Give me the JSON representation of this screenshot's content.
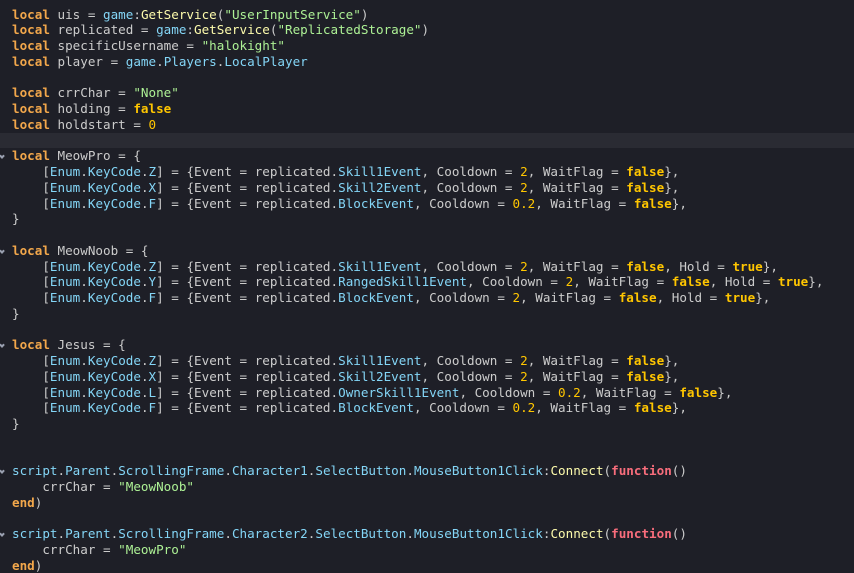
{
  "colors": {
    "background": "#1e1f27",
    "current_line": "#2a2b33",
    "keyword": "#f2a74b",
    "builtin": "#84d6f7",
    "method": "#fdfbac",
    "string": "#adf195",
    "boolean": "#ffc600",
    "number": "#ffc600",
    "function": "#f86d7c",
    "plain": "#cccccc"
  },
  "icons": {
    "fold": "fold-arrow-icon"
  },
  "lines": [
    {
      "tokens": [
        [
          "keyword",
          "local"
        ],
        [
          "plain",
          " uis = "
        ],
        [
          "builtin",
          "game"
        ],
        [
          "plain",
          ":"
        ],
        [
          "method",
          "GetService"
        ],
        [
          "plain",
          "("
        ],
        [
          "string",
          "\"UserInputService\""
        ],
        [
          "plain",
          ")"
        ]
      ]
    },
    {
      "tokens": [
        [
          "keyword",
          "local"
        ],
        [
          "plain",
          " replicated = "
        ],
        [
          "builtin",
          "game"
        ],
        [
          "plain",
          ":"
        ],
        [
          "method",
          "GetService"
        ],
        [
          "plain",
          "("
        ],
        [
          "string",
          "\"ReplicatedStorage\""
        ],
        [
          "plain",
          ")"
        ]
      ]
    },
    {
      "tokens": [
        [
          "keyword",
          "local"
        ],
        [
          "plain",
          " specificUsername = "
        ],
        [
          "string",
          "\"halokight\""
        ]
      ]
    },
    {
      "tokens": [
        [
          "keyword",
          "local"
        ],
        [
          "plain",
          " player = "
        ],
        [
          "builtin",
          "game"
        ],
        [
          "plain",
          "."
        ],
        [
          "builtin",
          "Players"
        ],
        [
          "plain",
          "."
        ],
        [
          "builtin",
          "LocalPlayer"
        ]
      ]
    },
    {
      "tokens": []
    },
    {
      "tokens": [
        [
          "keyword",
          "local"
        ],
        [
          "plain",
          " crrChar = "
        ],
        [
          "string",
          "\"None\""
        ]
      ]
    },
    {
      "tokens": [
        [
          "keyword",
          "local"
        ],
        [
          "plain",
          " holding = "
        ],
        [
          "boolean",
          "false"
        ]
      ]
    },
    {
      "tokens": [
        [
          "keyword",
          "local"
        ],
        [
          "plain",
          " holdstart = "
        ],
        [
          "number",
          "0"
        ]
      ]
    },
    {
      "current": true,
      "tokens": []
    },
    {
      "fold": true,
      "tokens": [
        [
          "keyword",
          "local"
        ],
        [
          "plain",
          " MeowPro = {"
        ]
      ]
    },
    {
      "tokens": [
        [
          "plain",
          "    ["
        ],
        [
          "builtin",
          "Enum"
        ],
        [
          "plain",
          "."
        ],
        [
          "builtin",
          "KeyCode"
        ],
        [
          "plain",
          "."
        ],
        [
          "builtin",
          "Z"
        ],
        [
          "plain",
          "] = {Event = replicated."
        ],
        [
          "builtin",
          "Skill1Event"
        ],
        [
          "plain",
          ", Cooldown = "
        ],
        [
          "number",
          "2"
        ],
        [
          "plain",
          ", WaitFlag = "
        ],
        [
          "boolean",
          "false"
        ],
        [
          "plain",
          "},"
        ]
      ]
    },
    {
      "tokens": [
        [
          "plain",
          "    ["
        ],
        [
          "builtin",
          "Enum"
        ],
        [
          "plain",
          "."
        ],
        [
          "builtin",
          "KeyCode"
        ],
        [
          "plain",
          "."
        ],
        [
          "builtin",
          "X"
        ],
        [
          "plain",
          "] = {Event = replicated."
        ],
        [
          "builtin",
          "Skill2Event"
        ],
        [
          "plain",
          ", Cooldown = "
        ],
        [
          "number",
          "2"
        ],
        [
          "plain",
          ", WaitFlag = "
        ],
        [
          "boolean",
          "false"
        ],
        [
          "plain",
          "},"
        ]
      ]
    },
    {
      "tokens": [
        [
          "plain",
          "    ["
        ],
        [
          "builtin",
          "Enum"
        ],
        [
          "plain",
          "."
        ],
        [
          "builtin",
          "KeyCode"
        ],
        [
          "plain",
          "."
        ],
        [
          "builtin",
          "F"
        ],
        [
          "plain",
          "] = {Event = replicated."
        ],
        [
          "builtin",
          "BlockEvent"
        ],
        [
          "plain",
          ", Cooldown = "
        ],
        [
          "number",
          "0.2"
        ],
        [
          "plain",
          ", WaitFlag = "
        ],
        [
          "boolean",
          "false"
        ],
        [
          "plain",
          "},"
        ]
      ]
    },
    {
      "tokens": [
        [
          "plain",
          "}"
        ]
      ]
    },
    {
      "tokens": []
    },
    {
      "fold": true,
      "tokens": [
        [
          "keyword",
          "local"
        ],
        [
          "plain",
          " MeowNoob = {"
        ]
      ]
    },
    {
      "tokens": [
        [
          "plain",
          "    ["
        ],
        [
          "builtin",
          "Enum"
        ],
        [
          "plain",
          "."
        ],
        [
          "builtin",
          "KeyCode"
        ],
        [
          "plain",
          "."
        ],
        [
          "builtin",
          "Z"
        ],
        [
          "plain",
          "] = {Event = replicated."
        ],
        [
          "builtin",
          "Skill1Event"
        ],
        [
          "plain",
          ", Cooldown = "
        ],
        [
          "number",
          "2"
        ],
        [
          "plain",
          ", WaitFlag = "
        ],
        [
          "boolean",
          "false"
        ],
        [
          "plain",
          ", Hold = "
        ],
        [
          "boolean",
          "true"
        ],
        [
          "plain",
          "},"
        ]
      ]
    },
    {
      "tokens": [
        [
          "plain",
          "    ["
        ],
        [
          "builtin",
          "Enum"
        ],
        [
          "plain",
          "."
        ],
        [
          "builtin",
          "KeyCode"
        ],
        [
          "plain",
          "."
        ],
        [
          "builtin",
          "Y"
        ],
        [
          "plain",
          "] = {Event = replicated."
        ],
        [
          "builtin",
          "RangedSkill1Event"
        ],
        [
          "plain",
          ", Cooldown = "
        ],
        [
          "number",
          "2"
        ],
        [
          "plain",
          ", WaitFlag = "
        ],
        [
          "boolean",
          "false"
        ],
        [
          "plain",
          ", Hold = "
        ],
        [
          "boolean",
          "true"
        ],
        [
          "plain",
          "},"
        ]
      ]
    },
    {
      "tokens": [
        [
          "plain",
          "    ["
        ],
        [
          "builtin",
          "Enum"
        ],
        [
          "plain",
          "."
        ],
        [
          "builtin",
          "KeyCode"
        ],
        [
          "plain",
          "."
        ],
        [
          "builtin",
          "F"
        ],
        [
          "plain",
          "] = {Event = replicated."
        ],
        [
          "builtin",
          "BlockEvent"
        ],
        [
          "plain",
          ", Cooldown = "
        ],
        [
          "number",
          "2"
        ],
        [
          "plain",
          ", WaitFlag = "
        ],
        [
          "boolean",
          "false"
        ],
        [
          "plain",
          ", Hold = "
        ],
        [
          "boolean",
          "true"
        ],
        [
          "plain",
          "},"
        ]
      ]
    },
    {
      "tokens": [
        [
          "plain",
          "}"
        ]
      ]
    },
    {
      "tokens": []
    },
    {
      "fold": true,
      "tokens": [
        [
          "keyword",
          "local"
        ],
        [
          "plain",
          " Jesus = {"
        ]
      ]
    },
    {
      "tokens": [
        [
          "plain",
          "    ["
        ],
        [
          "builtin",
          "Enum"
        ],
        [
          "plain",
          "."
        ],
        [
          "builtin",
          "KeyCode"
        ],
        [
          "plain",
          "."
        ],
        [
          "builtin",
          "Z"
        ],
        [
          "plain",
          "] = {Event = replicated."
        ],
        [
          "builtin",
          "Skill1Event"
        ],
        [
          "plain",
          ", Cooldown = "
        ],
        [
          "number",
          "2"
        ],
        [
          "plain",
          ", WaitFlag = "
        ],
        [
          "boolean",
          "false"
        ],
        [
          "plain",
          "},"
        ]
      ]
    },
    {
      "tokens": [
        [
          "plain",
          "    ["
        ],
        [
          "builtin",
          "Enum"
        ],
        [
          "plain",
          "."
        ],
        [
          "builtin",
          "KeyCode"
        ],
        [
          "plain",
          "."
        ],
        [
          "builtin",
          "X"
        ],
        [
          "plain",
          "] = {Event = replicated."
        ],
        [
          "builtin",
          "Skill2Event"
        ],
        [
          "plain",
          ", Cooldown = "
        ],
        [
          "number",
          "2"
        ],
        [
          "plain",
          ", WaitFlag = "
        ],
        [
          "boolean",
          "false"
        ],
        [
          "plain",
          "},"
        ]
      ]
    },
    {
      "tokens": [
        [
          "plain",
          "    ["
        ],
        [
          "builtin",
          "Enum"
        ],
        [
          "plain",
          "."
        ],
        [
          "builtin",
          "KeyCode"
        ],
        [
          "plain",
          "."
        ],
        [
          "builtin",
          "L"
        ],
        [
          "plain",
          "] = {Event = replicated."
        ],
        [
          "builtin",
          "OwnerSkill1Event"
        ],
        [
          "plain",
          ", Cooldown = "
        ],
        [
          "number",
          "0.2"
        ],
        [
          "plain",
          ", WaitFlag = "
        ],
        [
          "boolean",
          "false"
        ],
        [
          "plain",
          "},"
        ]
      ]
    },
    {
      "tokens": [
        [
          "plain",
          "    ["
        ],
        [
          "builtin",
          "Enum"
        ],
        [
          "plain",
          "."
        ],
        [
          "builtin",
          "KeyCode"
        ],
        [
          "plain",
          "."
        ],
        [
          "builtin",
          "F"
        ],
        [
          "plain",
          "] = {Event = replicated."
        ],
        [
          "builtin",
          "BlockEvent"
        ],
        [
          "plain",
          ", Cooldown = "
        ],
        [
          "number",
          "0.2"
        ],
        [
          "plain",
          ", WaitFlag = "
        ],
        [
          "boolean",
          "false"
        ],
        [
          "plain",
          "},"
        ]
      ]
    },
    {
      "tokens": [
        [
          "plain",
          "}"
        ]
      ]
    },
    {
      "tokens": []
    },
    {
      "tokens": []
    },
    {
      "fold": true,
      "tokens": [
        [
          "builtin",
          "script"
        ],
        [
          "plain",
          "."
        ],
        [
          "builtin",
          "Parent"
        ],
        [
          "plain",
          "."
        ],
        [
          "builtin",
          "ScrollingFrame"
        ],
        [
          "plain",
          "."
        ],
        [
          "builtin",
          "Character1"
        ],
        [
          "plain",
          "."
        ],
        [
          "builtin",
          "SelectButton"
        ],
        [
          "plain",
          "."
        ],
        [
          "builtin",
          "MouseButton1Click"
        ],
        [
          "plain",
          ":"
        ],
        [
          "method",
          "Connect"
        ],
        [
          "plain",
          "("
        ],
        [
          "function",
          "function"
        ],
        [
          "plain",
          "()"
        ]
      ]
    },
    {
      "tokens": [
        [
          "plain",
          "    crrChar = "
        ],
        [
          "string",
          "\"MeowNoob\""
        ]
      ]
    },
    {
      "tokens": [
        [
          "keyword",
          "end"
        ],
        [
          "plain",
          ")"
        ]
      ]
    },
    {
      "tokens": []
    },
    {
      "fold": true,
      "tokens": [
        [
          "builtin",
          "script"
        ],
        [
          "plain",
          "."
        ],
        [
          "builtin",
          "Parent"
        ],
        [
          "plain",
          "."
        ],
        [
          "builtin",
          "ScrollingFrame"
        ],
        [
          "plain",
          "."
        ],
        [
          "builtin",
          "Character2"
        ],
        [
          "plain",
          "."
        ],
        [
          "builtin",
          "SelectButton"
        ],
        [
          "plain",
          "."
        ],
        [
          "builtin",
          "MouseButton1Click"
        ],
        [
          "plain",
          ":"
        ],
        [
          "method",
          "Connect"
        ],
        [
          "plain",
          "("
        ],
        [
          "function",
          "function"
        ],
        [
          "plain",
          "()"
        ]
      ]
    },
    {
      "tokens": [
        [
          "plain",
          "    crrChar = "
        ],
        [
          "string",
          "\"MeowPro\""
        ]
      ]
    },
    {
      "tokens": [
        [
          "keyword",
          "end"
        ],
        [
          "plain",
          ")"
        ]
      ]
    }
  ]
}
